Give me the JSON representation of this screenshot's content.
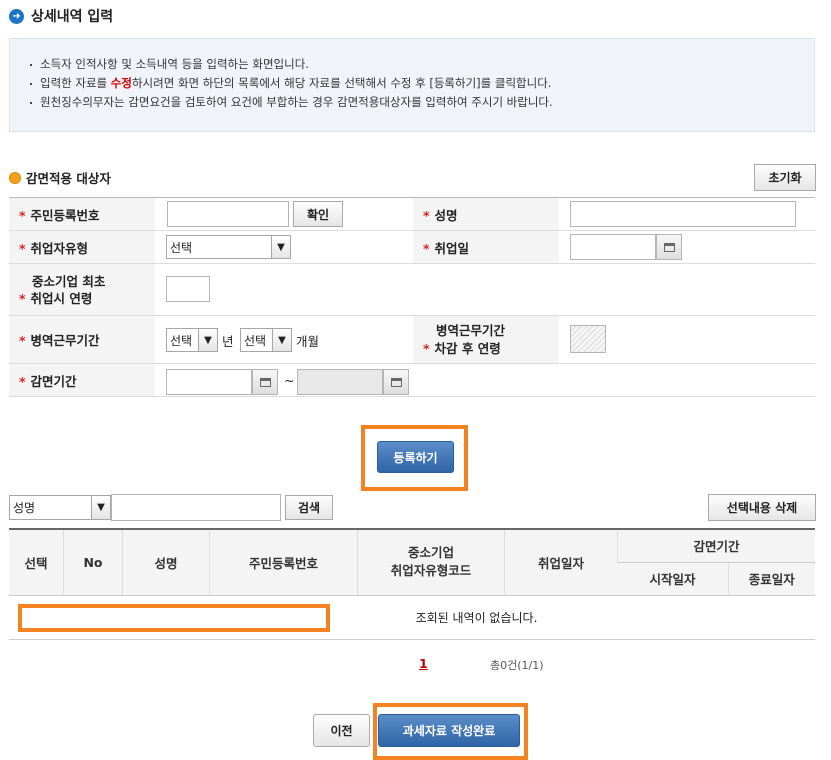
{
  "page": {
    "title": "상세내역 입력",
    "info_lines": [
      {
        "pre": "소득자 인적사항 및 소득내역 등을 입력하는 화면입니다.",
        "mid": "",
        "post": ""
      },
      {
        "pre": "입력한 자료를 ",
        "mid": "수정",
        "post": "하시려면 화면 하단의 목록에서 해당 자료를 선택해서 수정 후 [등록하기]를 클릭합니다."
      },
      {
        "pre": "원천징수의무자는 감면요건을 검토하여 요건에 부합하는 경우 감면적용대상자를 입력하여 주시기 바랍니다.",
        "mid": "",
        "post": ""
      }
    ]
  },
  "section": {
    "title": "감면적용 대상자",
    "reset_button": "초기화"
  },
  "form": {
    "ssn_label": "주민등록번호",
    "ssn_value": "",
    "confirm_button": "확인",
    "name_label": "성명",
    "name_value": "",
    "employ_type_label": "취업자유형",
    "employ_type_value": "선택",
    "employ_date_label": "취업일",
    "employ_date_value": "",
    "age_label_line1": "중소기업 최초",
    "age_label_line2": "취업시 연령",
    "age_value": "",
    "military_label": "병역근무기간",
    "military_year_value": "선택",
    "year_unit": "년",
    "military_month_value": "선택",
    "month_unit": "개월",
    "after_age_label_line1": "병역근무기간",
    "after_age_label_line2": "차감 후 연령",
    "period_label": "감면기간",
    "period_start": "",
    "period_sep": "~",
    "period_end": "",
    "required_mark": "*",
    "register_button": "등록하기"
  },
  "search": {
    "field_value": "성명",
    "query": "",
    "search_button": "검색",
    "delete_button": "선택내용 삭제"
  },
  "list": {
    "headers": {
      "select": "선택",
      "no": "No",
      "name": "성명",
      "ssn": "주민등록번호",
      "code_line1": "중소기업",
      "code_line2": "취업자유형코드",
      "employ_date": "취업일자",
      "period": "감면기간",
      "start": "시작일자",
      "end": "종료일자"
    },
    "empty_message": "조회된 내역이 없습니다.",
    "page_number": "1",
    "total": "총0건(1/1)"
  },
  "footer": {
    "prev_button": "이전",
    "complete_button": "과세자료 작성완료"
  },
  "colors": {
    "accent_blue": "#2f64a6",
    "highlight_orange": "#f58220",
    "required_red": "#d22222"
  }
}
